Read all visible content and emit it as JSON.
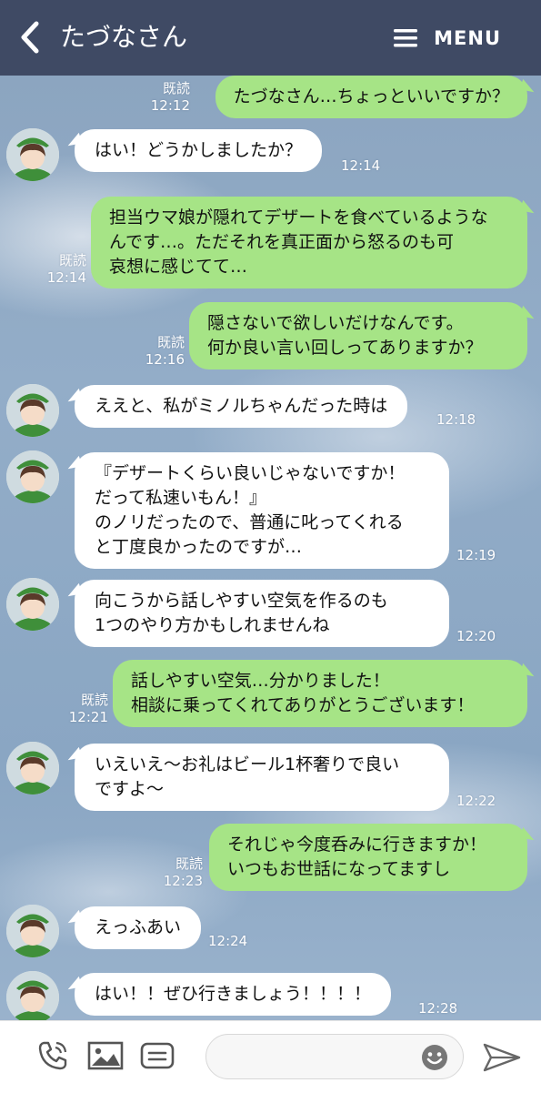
{
  "header": {
    "title": "たづなさん",
    "menu_label": "MENU"
  },
  "chat": {
    "read_label": "既読",
    "messages": [
      {
        "dir": "out",
        "text": "たづなさん…ちょっといいですか？",
        "time": "12:12",
        "read": true
      },
      {
        "dir": "in",
        "text": "はい！どうかしましたか？",
        "time": "12:14"
      },
      {
        "dir": "out",
        "text": "担当ウマ娘が隠れてデザートを食べているような\nんです…。ただそれを真正面から怒るのも可\n哀想に感じてて…",
        "time": "12:14",
        "read": true
      },
      {
        "dir": "out",
        "text": "隠さないで欲しいだけなんです。\n何か良い言い回しってありますか？",
        "time": "12:16",
        "read": true
      },
      {
        "dir": "in",
        "text": "ええと、私がミノルちゃんだった時は",
        "time": "12:18"
      },
      {
        "dir": "in",
        "text": "『デザートくらい良いじゃないですか！\nだって私速いもん！』\nのノリだったので、普通に叱ってくれる\nと丁度良かったのですが…",
        "time": "12:19"
      },
      {
        "dir": "in",
        "text": "向こうから話しやすい空気を作るのも\n1つのやり方かもしれませんね",
        "time": "12:20"
      },
      {
        "dir": "out",
        "text": "話しやすい空気…分かりました！\n相談に乗ってくれてありがとうございます！",
        "time": "12:21",
        "read": true
      },
      {
        "dir": "in",
        "text": "いえいえ〜お礼はビール1杯奢りで良い\nですよ〜",
        "time": "12:22"
      },
      {
        "dir": "out",
        "text": "それじゃ今度呑みに行きますか！\nいつもお世話になってますし",
        "time": "12:23",
        "read": true
      },
      {
        "dir": "in",
        "text": "えっふあい",
        "time": "12:24"
      },
      {
        "dir": "in",
        "text": "はい！！ぜひ行きましょう！！！！",
        "time": "12:28"
      }
    ]
  },
  "input": {
    "placeholder": ""
  },
  "icons": {
    "back": "chevron-left-icon",
    "menu": "hamburger-icon",
    "call": "phone-icon",
    "image": "image-icon",
    "template": "message-template-icon",
    "emoji": "smiley-icon",
    "send": "send-icon"
  },
  "colors": {
    "header_bg": "#3f4a64",
    "outgoing_bubble": "#a6e486",
    "incoming_bubble": "#ffffff",
    "avatar_hat": "#3f8f3a",
    "avatar_hair": "#5a3a2a"
  }
}
